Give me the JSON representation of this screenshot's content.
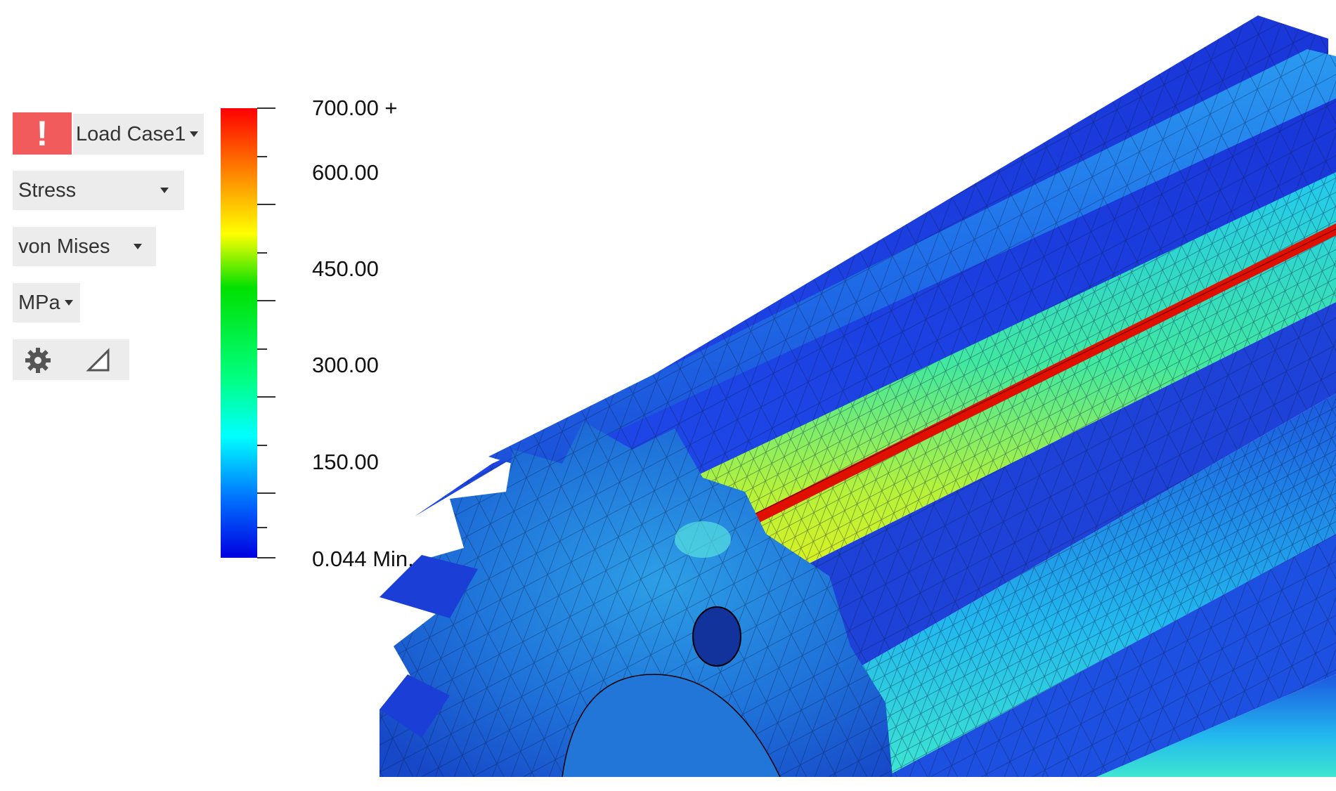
{
  "toolbar": {
    "warning_symbol": "!",
    "load_case": "Load Case1",
    "result_type": "Stress",
    "component": "von Mises",
    "unit": "MPa",
    "icons": [
      "gear-icon",
      "probe-triangle-icon"
    ]
  },
  "legend": {
    "max_label": "700.00 +",
    "labels": [
      "600.00",
      "450.00",
      "300.00",
      "150.00"
    ],
    "min_label": "0.044 Min.",
    "gradient_colors": [
      "#ff0000",
      "#ff8a00",
      "#ffff00",
      "#00e000",
      "#00ffff",
      "#0070ff",
      "#0000e0"
    ]
  },
  "colors": {
    "warning": "#f25b5b",
    "control_bg": "#ececec",
    "model_blue": "#1a55e6",
    "hotspot": "#e01000"
  }
}
